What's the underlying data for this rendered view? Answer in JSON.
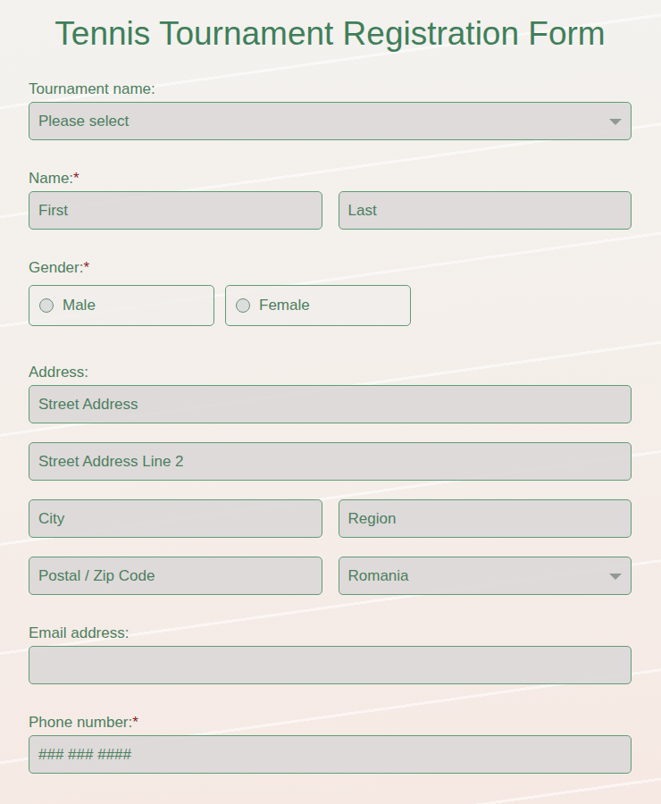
{
  "title": "Tennis Tournament Registration Form",
  "required_marker": "*",
  "tournament": {
    "label": "Tournament name:",
    "required": false,
    "value": "Please select"
  },
  "name": {
    "label": "Name:",
    "required": true,
    "first_placeholder": "First",
    "last_placeholder": "Last"
  },
  "gender": {
    "label": "Gender:",
    "required": true,
    "options": [
      {
        "label": "Male",
        "selected": false
      },
      {
        "label": "Female",
        "selected": false
      }
    ]
  },
  "address": {
    "label": "Address:",
    "required": false,
    "street_placeholder": "Street Address",
    "street2_placeholder": "Street Address Line 2",
    "city_placeholder": "City",
    "region_placeholder": "Region",
    "postal_placeholder": "Postal / Zip Code",
    "country_value": "Romania"
  },
  "email": {
    "label": "Email address:",
    "required": false,
    "placeholder": ""
  },
  "phone": {
    "label": "Phone number:",
    "required": true,
    "placeholder": "### ### ####"
  }
}
